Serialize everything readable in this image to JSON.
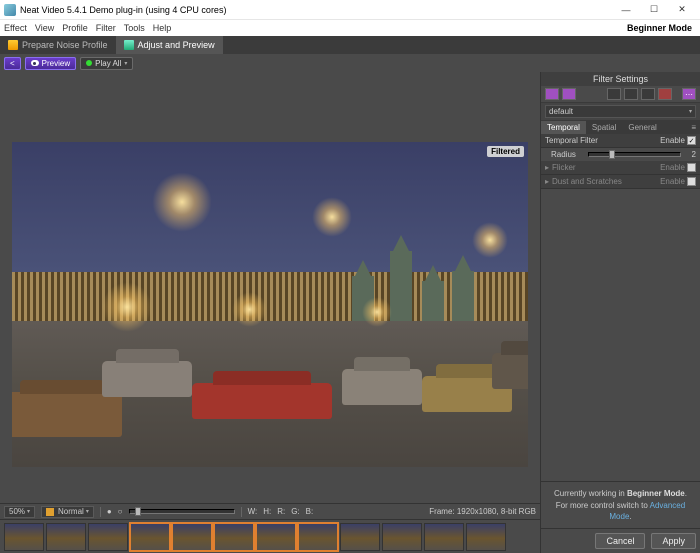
{
  "window": {
    "title": "Neat Video 5.4.1 Demo plug-in (using 4 CPU cores)",
    "controls": {
      "min": "—",
      "max": "☐",
      "close": "✕"
    }
  },
  "menu": [
    "Effect",
    "View",
    "Profile",
    "Filter",
    "Tools",
    "Help"
  ],
  "mode_label": "Beginner Mode",
  "tabs": {
    "prepare": "Prepare Noise Profile",
    "adjust": "Adjust and Preview"
  },
  "toolbar": {
    "preview": "Preview",
    "playall": "Play All"
  },
  "viewport": {
    "overlay_label": "Filtered"
  },
  "status": {
    "zoom": "50%",
    "blend": "Normal",
    "w": "W:",
    "h": "H:",
    "r": "R:",
    "g": "G:",
    "b": "B:",
    "frame_info": "Frame: 1920x1080, 8-bit RGB"
  },
  "filter_panel": {
    "title": "Filter Settings",
    "preset": "default",
    "tabs": {
      "temporal": "Temporal",
      "spatial": "Spatial",
      "general": "General"
    },
    "section_temporal": {
      "title": "Temporal Filter",
      "enable_label": "Enable"
    },
    "radius": {
      "label": "Radius",
      "value": "2"
    },
    "flicker": {
      "title": "Flicker",
      "enable_label": "Enable"
    },
    "dust": {
      "title": "Dust and Scratches",
      "enable_label": "Enable"
    }
  },
  "footer": {
    "line1_a": "Currently working in ",
    "line1_b": "Beginner Mode",
    "line1_c": ".",
    "line2_a": "For more control switch to ",
    "line2_b": "Advanced Mode",
    "line2_c": "."
  },
  "buttons": {
    "cancel": "Cancel",
    "apply": "Apply"
  }
}
